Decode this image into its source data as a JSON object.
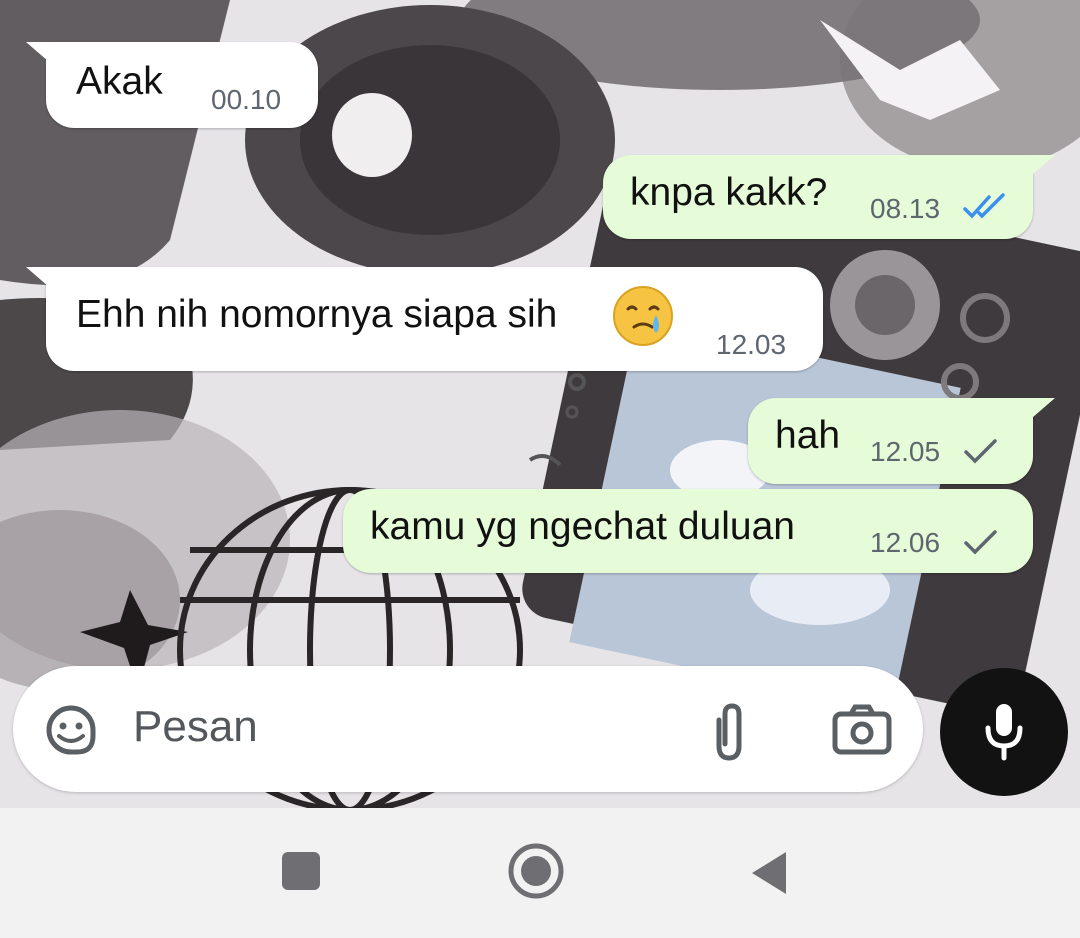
{
  "messages": [
    {
      "direction": "incoming",
      "text": "Akak",
      "time": "00.10"
    },
    {
      "direction": "outgoing",
      "text": "knpa kakk?",
      "time": "08.13",
      "status": "read"
    },
    {
      "direction": "incoming",
      "text": "Ehh nih nomornya siapa sih",
      "emoji": "crying-face",
      "time": "12.03"
    },
    {
      "direction": "outgoing",
      "text": "hah",
      "time": "12.05",
      "status": "sent"
    },
    {
      "direction": "outgoing",
      "text": "kamu yg ngechat duluan",
      "time": "12.06",
      "status": "sent"
    }
  ],
  "composer": {
    "placeholder": "Pesan",
    "icons": [
      "sticker-icon",
      "attach-icon",
      "camera-icon"
    ]
  },
  "mic_button": {
    "icon": "mic-icon"
  },
  "navbar": {
    "icons": [
      "recents-icon",
      "home-icon",
      "back-icon"
    ]
  },
  "colors": {
    "outgoing_bubble": "#e6fcd8",
    "incoming_bubble": "#ffffff",
    "read_tick": "#3b8ff0",
    "sent_tick": "#5e6670",
    "mic_button": "#121212"
  }
}
